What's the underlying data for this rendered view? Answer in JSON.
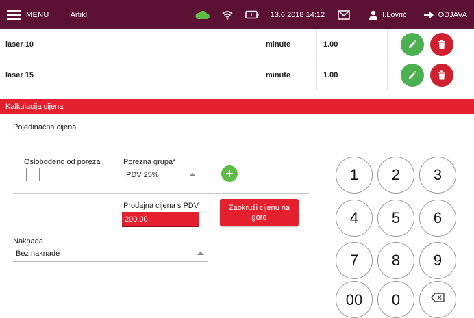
{
  "topbar": {
    "menu_label": "MENU",
    "title": "Artikl",
    "datetime": "13.6.2018 14:12",
    "user": "I.Lovrić",
    "logout": "ODJAVA",
    "bar_color": "#5c1034",
    "icons": [
      "hamburger-icon",
      "cloud-icon",
      "wifi-icon",
      "battery-icon",
      "mail-icon",
      "user-icon",
      "logout-arrow-icon"
    ]
  },
  "rows": [
    {
      "name": "laser 10",
      "unit": "minute",
      "value": "1.00"
    },
    {
      "name": "laser 15",
      "unit": "minute",
      "value": "1.00"
    }
  ],
  "section": {
    "title": "Kalkulacija cijena",
    "color": "#e4202e"
  },
  "form": {
    "single_price_label": "Pojedinačna cijena",
    "tax_exempt_label": "Oslobođeno od poreza",
    "tax_group_label": "Porezna grupa*",
    "tax_group_value": "PDV 25%",
    "sale_price_label": "Prodajna cijena s PDV",
    "sale_price_value": "200.00",
    "round_button_label": "Zaokruži cijenu na gore",
    "fee_label": "Naknada",
    "fee_value": "Bez naknade"
  },
  "keypad": {
    "keys": [
      "1",
      "2",
      "3",
      "4",
      "5",
      "6",
      "7",
      "8",
      "9",
      "00",
      "0"
    ],
    "backspace_icon": "backspace-icon"
  },
  "colors": {
    "edit": "#4caf50",
    "delete": "#d0202f",
    "add": "#5dbb46",
    "cloud": "#5dbb46"
  }
}
